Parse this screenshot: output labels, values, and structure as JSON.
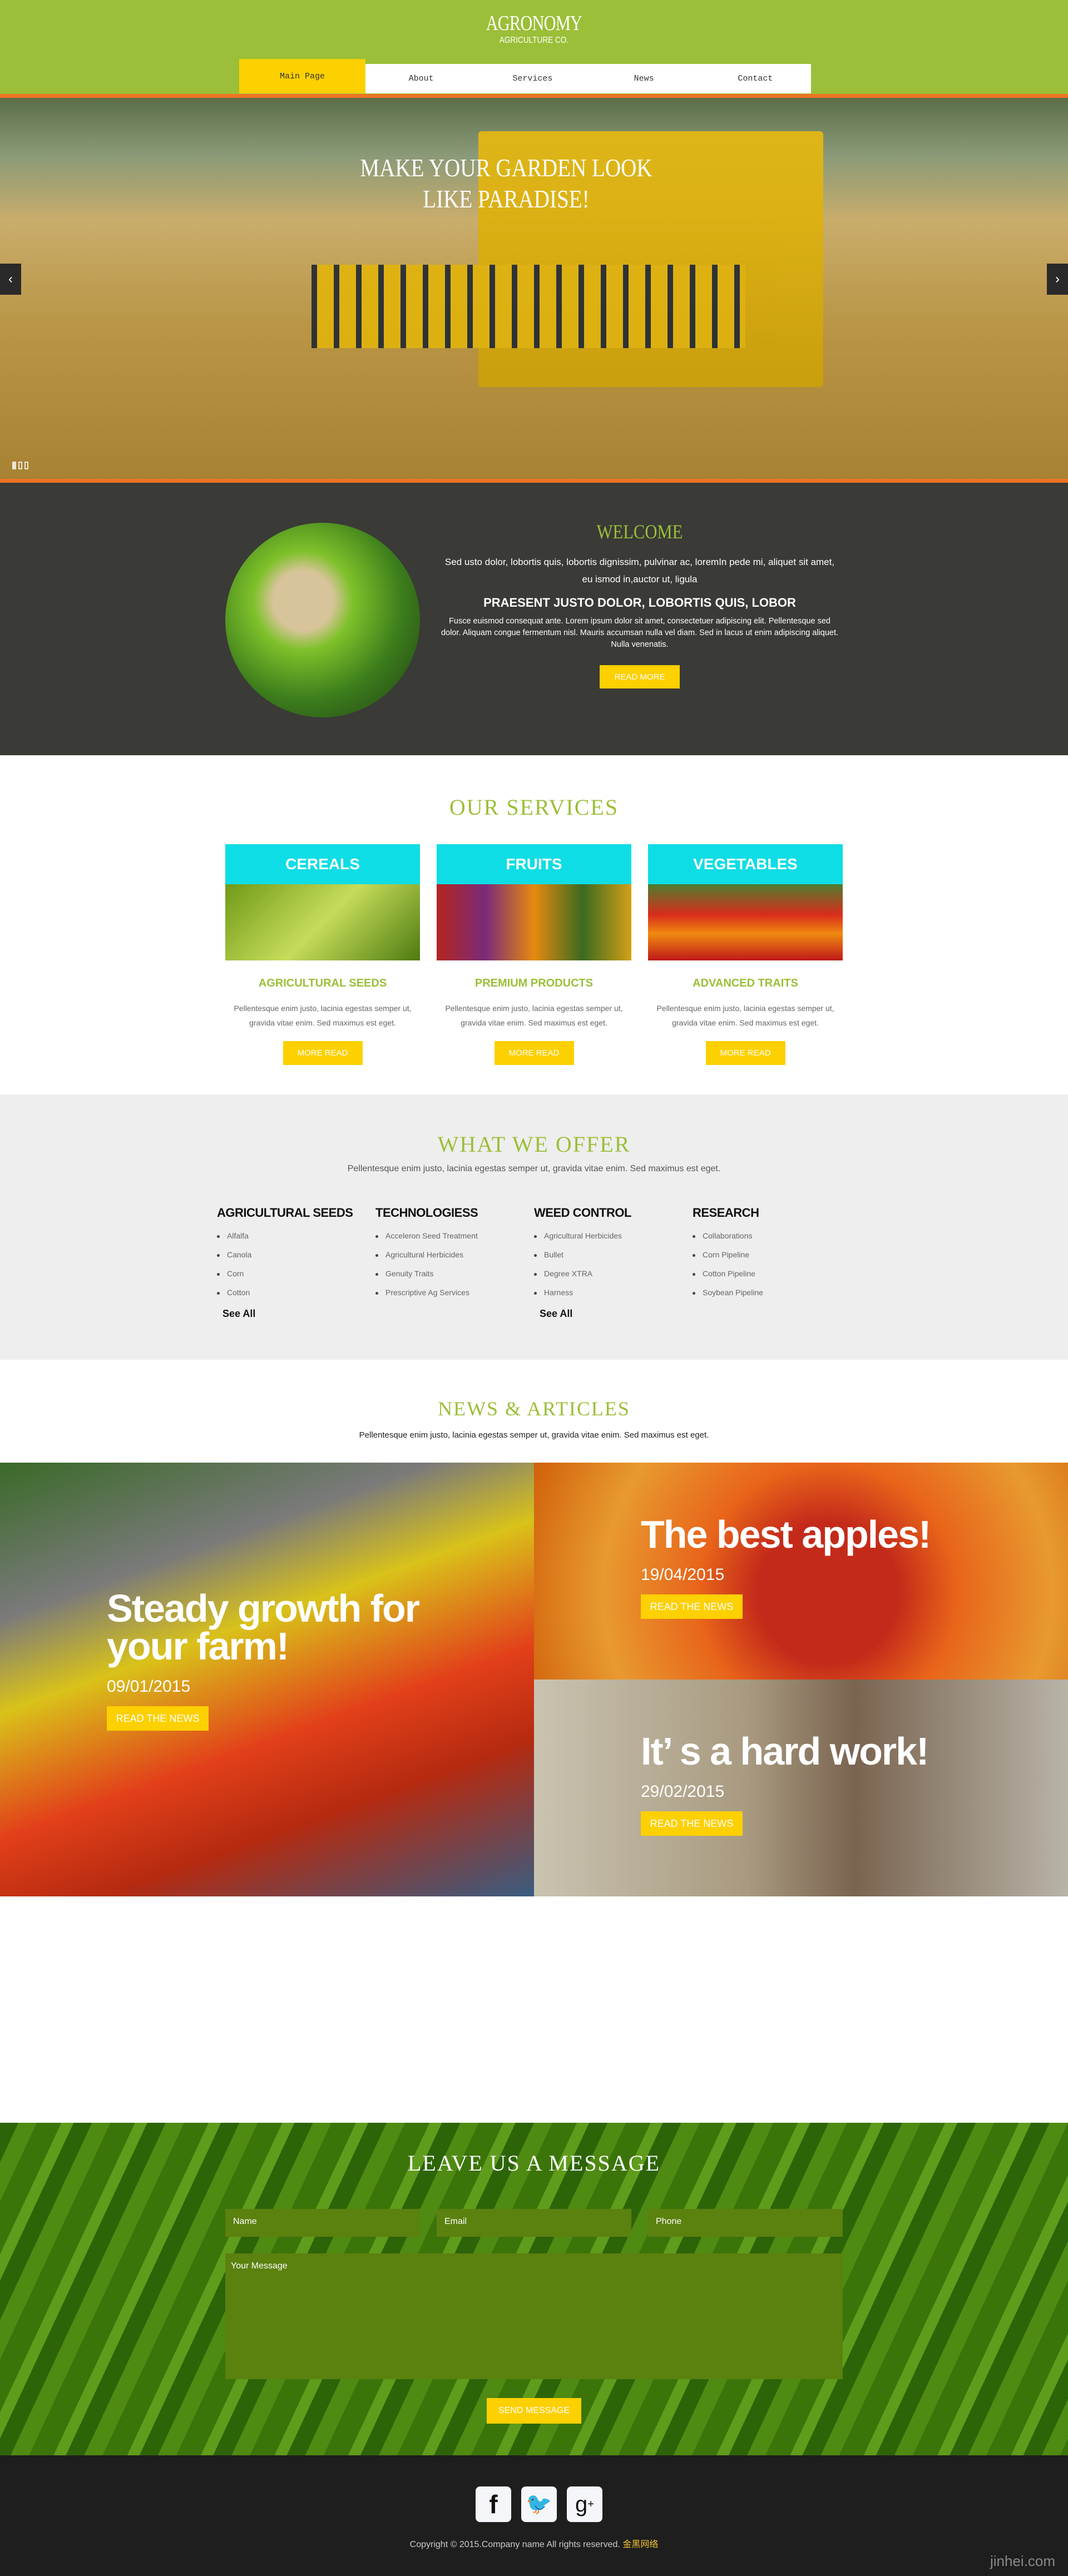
{
  "brand": {
    "title": "AGRONOMY",
    "subtitle": "AGRICULTURE CO."
  },
  "nav": [
    {
      "label": "Main Page",
      "active": true
    },
    {
      "label": "About"
    },
    {
      "label": "Services"
    },
    {
      "label": "News"
    },
    {
      "label": "Contact"
    }
  ],
  "hero": {
    "title": "MAKE YOUR GARDEN LOOK LIKE PARADISE!",
    "prev_icon": "chevron-left-icon",
    "next_icon": "chevron-right-icon",
    "slides": 3,
    "active_slide": 1
  },
  "welcome": {
    "title": "WELCOME",
    "intro": "Sed usto dolor, lobortis quis, lobortis dignissim, pulvinar ac, loremIn pede mi, aliquet sit amet, eu ismod in,auctor ut, ligula",
    "heading": "PRAESENT JUSTO DOLOR, LOBORTIS QUIS, LOBOR",
    "body": "Fusce euismod consequat ante. Lorem ipsum dolor sit amet, consectetuer adipiscing elit. Pellentesque sed dolor. Aliquam congue fermentum nisl. Mauris accumsan nulla vel diam. Sed in lacus ut enim adipiscing aliquet. Nulla venenatis.",
    "button": "READ MORE"
  },
  "services": {
    "title": "OUR SERVICES",
    "cards": [
      {
        "header": "CEREALS",
        "subtitle": "AGRICULTURAL SEEDS",
        "text": "Pellentesque enim justo, lacinia egestas semper ut, gravida vitae enim. Sed maximus est eget.",
        "button": "MORE READ"
      },
      {
        "header": "FRUITS",
        "subtitle": "PREMIUM PRODUCTS",
        "text": "Pellentesque enim justo, lacinia egestas semper ut, gravida vitae enim. Sed maximus est eget.",
        "button": "MORE READ"
      },
      {
        "header": "VEGETABLES",
        "subtitle": "ADVANCED TRAITS",
        "text": "Pellentesque enim justo, lacinia egestas semper ut, gravida vitae enim. Sed maximus est eget.",
        "button": "MORE READ"
      }
    ]
  },
  "offer": {
    "title": "WHAT WE OFFER",
    "subtitle": "Pellentesque enim justo, lacinia egestas semper ut, gravida vitae enim. Sed maximus est eget.",
    "columns": [
      {
        "heading": "AGRICULTURAL SEEDS",
        "items": [
          "Alfalfa",
          "Canola",
          "Corn",
          "Cotton"
        ],
        "link": "See All"
      },
      {
        "heading": "TECHNOLOGIESS",
        "items": [
          "Acceleron Seed Treatment",
          "Agricultural Herbicides",
          "Genuity Traits",
          "Prescriptive Ag Services"
        ]
      },
      {
        "heading": "WEED CONTROL",
        "items": [
          "Agricultural Herbicides",
          "Bullet",
          "Degree XTRA",
          "Harness"
        ],
        "link": "See All"
      },
      {
        "heading": "RESEARCH",
        "items": [
          "Collaborations",
          "Corn Pipeline",
          "Cotton Pipeline",
          "Soybean Pipeline"
        ]
      }
    ]
  },
  "news": {
    "title": "NEWS & ARTICLES",
    "subtitle": "Pellentesque enim justo, lacinia egestas semper ut, gravida vitae enim. Sed maximus est eget.",
    "articles": [
      {
        "title": "Steady growth for your farm!",
        "date": "09/01/2015",
        "button": "READ THE NEWS"
      },
      {
        "title": "The best apples!",
        "date": "19/04/2015",
        "button": "READ THE NEWS"
      },
      {
        "title": "It’ s a hard work!",
        "date": "29/02/2015",
        "button": "READ THE NEWS"
      }
    ]
  },
  "contact": {
    "title": "LEAVE US A MESSAGE",
    "name_placeholder": "Name",
    "email_placeholder": "Email",
    "phone_placeholder": "Phone",
    "message_placeholder": "Your Message",
    "button": "SEND MESSAGE"
  },
  "footer": {
    "social": [
      "facebook-icon",
      "twitter-icon",
      "google-plus-icon"
    ],
    "copyright": "Copyright © 2015.Company name All rights reserved.",
    "link": "金黑网络",
    "watermark": "jinhei.com"
  },
  "colors": {
    "brand_green": "#9bbf38",
    "accent_yellow": "#fdd000",
    "orange": "#ee7422",
    "cyan": "#0fdde5",
    "dark": "#3a3a37"
  }
}
